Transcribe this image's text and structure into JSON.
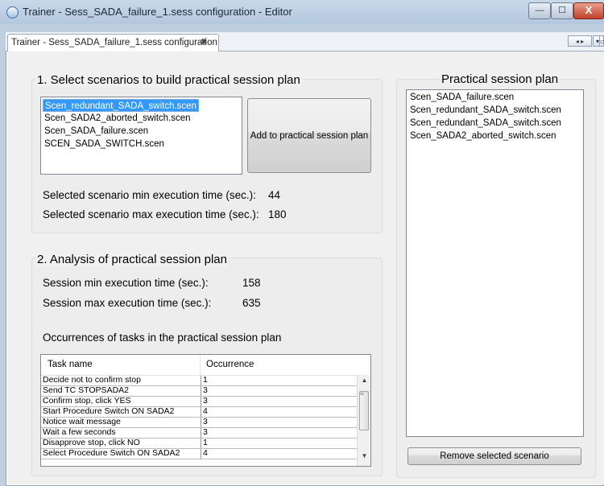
{
  "window": {
    "title": "Trainer - Sess_SADA_failure_1.sess configuration - Editor",
    "buttons": {
      "minimize": "—",
      "maximize": "☐",
      "close": "X"
    }
  },
  "tab": {
    "label": "Trainer - Sess_SADA_failure_1.sess configuration",
    "close_glyph": "✖"
  },
  "tab_nav": {
    "scroll": "◂ ▸",
    "menu": "▾",
    "maximize": "▭"
  },
  "section1": {
    "heading": "1. Select scenarios to build practical session plan",
    "scenarios": [
      {
        "name": "Scen_redundant_SADA_switch.scen",
        "selected": true
      },
      {
        "name": "Scen_SADA2_aborted_switch.scen",
        "selected": false
      },
      {
        "name": "Scen_SADA_failure.scen",
        "selected": false
      },
      {
        "name": "SCEN_SADA_SWITCH.scen",
        "selected": false
      }
    ],
    "add_button": "Add to practical session plan",
    "min_label": "Selected scenario min execution time (sec.):",
    "min_value": "44",
    "max_label": "Selected scenario max execution time (sec.):",
    "max_value": "180"
  },
  "section2": {
    "heading": "2. Analysis of practical session plan",
    "min_label": "Session min execution time (sec.):",
    "min_value": "158",
    "max_label": "Session max execution time (sec.):",
    "max_value": "635",
    "table_title": "Occurrences of tasks in the practical session plan",
    "columns": [
      "Task name",
      "Occurrence"
    ],
    "rows": [
      [
        "Decide not to confirm stop",
        "1"
      ],
      [
        "Send TC STOPSADA2",
        "3"
      ],
      [
        "Confirm stop, click YES",
        "3"
      ],
      [
        "Start Procedure Switch ON SADA2",
        "4"
      ],
      [
        "Notice wait message",
        "3"
      ],
      [
        "Wait a few seconds",
        "3"
      ],
      [
        "Disapprove stop, click NO",
        "1"
      ],
      [
        "Select Procedure Switch ON SADA2",
        "4"
      ]
    ]
  },
  "section3": {
    "heading": "Practical session plan",
    "items": [
      "Scen_SADA_failure.scen",
      "Scen_redundant_SADA_switch.scen",
      "Scen_redundant_SADA_switch.scen",
      "Scen_SADA2_aborted_switch.scen"
    ],
    "remove_button": "Remove selected scenario"
  }
}
